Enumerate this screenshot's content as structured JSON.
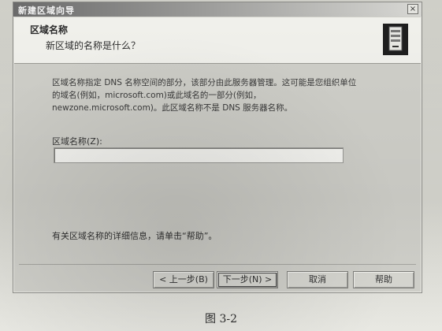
{
  "window": {
    "title": "新建区域向导",
    "close_glyph": "×"
  },
  "header": {
    "title": "区域名称",
    "subtitle": "新区域的名称是什么？",
    "icon": "server-icon"
  },
  "content": {
    "description": "区域名称指定 DNS 名称空间的部分，该部分由此服务器管理。这可能是您组织单位的域名(例如，microsoft.com)或此域名的一部分(例如，newzone.microsoft.com)。此区域名称不是 DNS 服务器名称。",
    "zone_name_label": "区域名称(Z):",
    "zone_name_value": "",
    "help_note": "有关区域名称的详细信息，请单击“帮助”。"
  },
  "buttons": {
    "back": "< 上一步(B)",
    "next": "下一步(N) >",
    "cancel": "取消",
    "help": "帮助"
  },
  "caption": "图 3-2"
}
